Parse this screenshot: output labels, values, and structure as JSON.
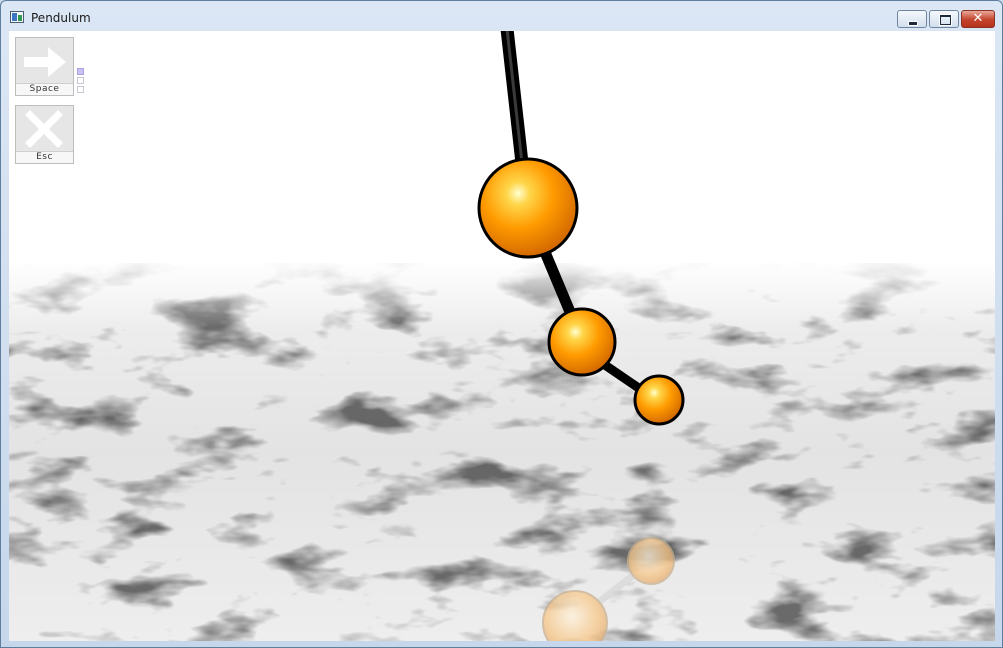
{
  "window": {
    "title": "Pendulum",
    "icon": "app-window-icon"
  },
  "title_buttons": {
    "minimize": "minimize-icon",
    "maximize": "restore-icon",
    "close": "close-icon",
    "close_glyph": "✕"
  },
  "overlay": {
    "space_button": {
      "label": "Space",
      "icon": "arrow-right-icon"
    },
    "esc_button": {
      "label": "Esc",
      "icon": "x-icon"
    },
    "speed_indicator": {
      "levels": 3,
      "active_level": 1
    }
  },
  "scene": {
    "pendulum_color": "#ff9a00",
    "rod_color": "#111111",
    "floor": "white marble"
  }
}
